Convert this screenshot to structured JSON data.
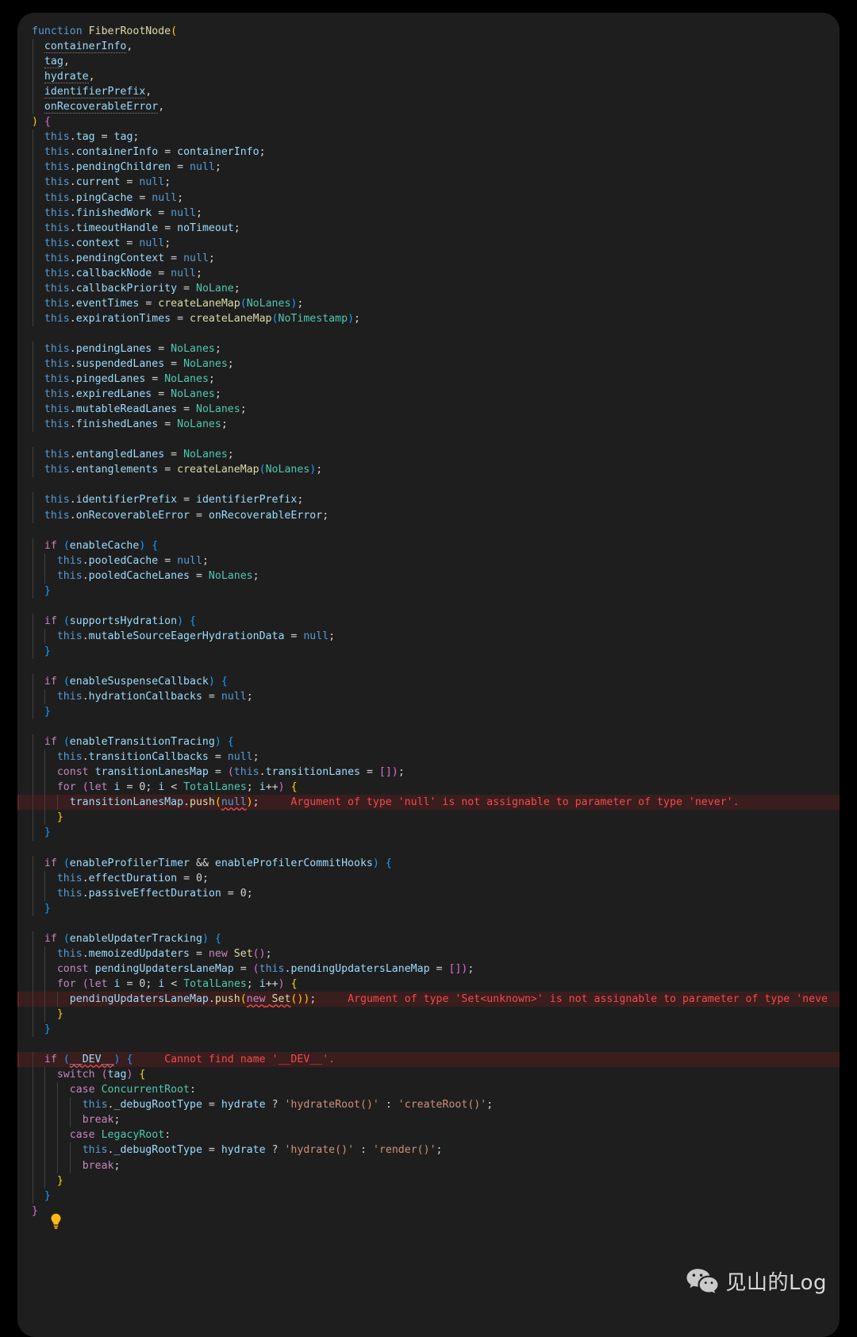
{
  "editor": {
    "language": "typescript",
    "theme": "Dark+ (default dark)",
    "background_color": "#1e1e1e",
    "page_background_color": "#000000",
    "error_row_color": "#3a1d1d",
    "error_text_color": "#f14c4c"
  },
  "code_lines": [
    "function FiberRootNode(",
    "  containerInfo,",
    "  tag,",
    "  hydrate,",
    "  identifierPrefix,",
    "  onRecoverableError,",
    ") {",
    "  this.tag = tag;",
    "  this.containerInfo = containerInfo;",
    "  this.pendingChildren = null;",
    "  this.current = null;",
    "  this.pingCache = null;",
    "  this.finishedWork = null;",
    "  this.timeoutHandle = noTimeout;",
    "  this.context = null;",
    "  this.pendingContext = null;",
    "  this.callbackNode = null;",
    "  this.callbackPriority = NoLane;",
    "  this.eventTimes = createLaneMap(NoLanes);",
    "  this.expirationTimes = createLaneMap(NoTimestamp);",
    "",
    "  this.pendingLanes = NoLanes;",
    "  this.suspendedLanes = NoLanes;",
    "  this.pingedLanes = NoLanes;",
    "  this.expiredLanes = NoLanes;",
    "  this.mutableReadLanes = NoLanes;",
    "  this.finishedLanes = NoLanes;",
    "",
    "  this.entangledLanes = NoLanes;",
    "  this.entanglements = createLaneMap(NoLanes);",
    "",
    "  this.identifierPrefix = identifierPrefix;",
    "  this.onRecoverableError = onRecoverableError;",
    "",
    "  if (enableCache) {",
    "    this.pooledCache = null;",
    "    this.pooledCacheLanes = NoLanes;",
    "  }",
    "",
    "  if (supportsHydration) {",
    "    this.mutableSourceEagerHydrationData = null;",
    "  }",
    "",
    "  if (enableSuspenseCallback) {",
    "    this.hydrationCallbacks = null;",
    "  }",
    "",
    "  if (enableTransitionTracing) {",
    "    this.transitionCallbacks = null;",
    "    const transitionLanesMap = (this.transitionLanes = []);",
    "    for (let i = 0; i < TotalLanes; i++) {",
    "      transitionLanesMap.push(null);",
    "    }",
    "  }",
    "",
    "  if (enableProfilerTimer && enableProfilerCommitHooks) {",
    "    this.effectDuration = 0;",
    "    this.passiveEffectDuration = 0;",
    "  }",
    "",
    "  if (enableUpdaterTracking) {",
    "    this.memoizedUpdaters = new Set();",
    "    const pendingUpdatersLaneMap = (this.pendingUpdatersLaneMap = []);",
    "    for (let i = 0; i < TotalLanes; i++) {",
    "      pendingUpdatersLaneMap.push(new Set());",
    "    }",
    "  }",
    "",
    "  if (__DEV__) {",
    "    switch (tag) {",
    "      case ConcurrentRoot:",
    "        this._debugRootType = hydrate ? 'hydrateRoot()' : 'createRoot()';",
    "        break;",
    "      case LegacyRoot:",
    "        this._debugRootType = hydrate ? 'hydrate()' : 'render()';",
    "        break;",
    "    }",
    "  }",
    "}"
  ],
  "diagnostics": [
    {
      "line_text": "      transitionLanesMap.push(null);",
      "squiggle_token": "null",
      "message": "Argument of type 'null' is not assignable to parameter of type 'never'."
    },
    {
      "line_text": "      pendingUpdatersLaneMap.push(new Set());",
      "squiggle_token": "new Set()",
      "message": "Argument of type 'Set<unknown>' is not assignable to parameter of type 'neve"
    },
    {
      "line_text": "  if (__DEV__) {",
      "squiggle_token": "__DEV__",
      "message": "Cannot find name '__DEV__'."
    }
  ],
  "quick_fix": {
    "icon": "lightbulb-icon",
    "color": "#fdb813",
    "tooltip": "Show Quick Fixes"
  },
  "watermark": {
    "icon": "wechat-icon",
    "label": "见山的Log"
  }
}
